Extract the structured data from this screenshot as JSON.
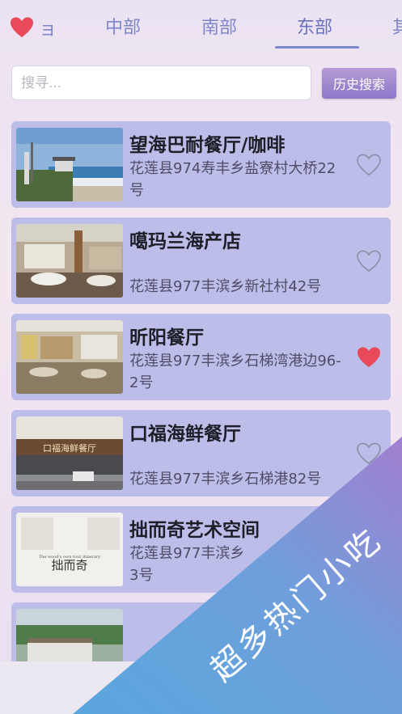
{
  "header": {
    "tab_partial_left": "ョ",
    "tabs": [
      "中部",
      "南部",
      "东部"
    ],
    "tab_partial_right": "其",
    "active_tab": "东部"
  },
  "search": {
    "placeholder": "搜寻...",
    "history_button": "历史搜索"
  },
  "restaurants": [
    {
      "name": "望海巴耐餐厅/咖啡",
      "address": "花莲县974寿丰乡盐寮村大桥22号",
      "favorited": false
    },
    {
      "name": "噶玛兰海产店",
      "address": "花莲县977丰滨乡新社村42号",
      "favorited": false
    },
    {
      "name": "昕阳餐厅",
      "address": "花莲县977丰滨乡石梯湾港边96-2号",
      "favorited": true
    },
    {
      "name": "口福海鲜餐厅",
      "address": "花莲县977丰滨乡石梯港82号",
      "favorited": false
    },
    {
      "name": "拙而奇艺术空间",
      "address": "花莲县977丰滨乡",
      "address_line2": "3号",
      "favorited": false
    },
    {
      "name": "",
      "address": "",
      "favorited": false
    }
  ],
  "thumbnail_captions": {
    "card4_sign": "口福海鲜餐厅",
    "card5_logo": "拙而奇",
    "card5_sub": "The wood's own tour itinerary"
  },
  "promo": {
    "text": "超多热门小吃"
  },
  "colors": {
    "accent": "#7d86c9",
    "card_bg": "#bcbde9",
    "heart_filled": "#e84a5a",
    "banner_start": "#5aa7dd",
    "banner_end": "#a27fcf"
  }
}
